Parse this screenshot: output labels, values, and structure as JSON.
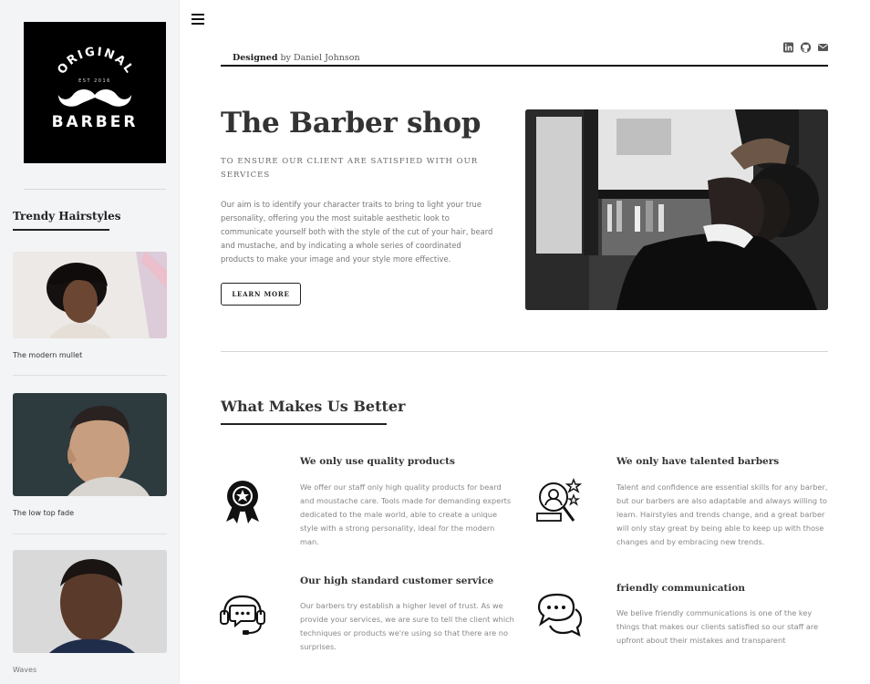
{
  "sidebar": {
    "logo": {
      "top": "ORIGINAL",
      "est": "EST 2016",
      "bottom": "BARBER"
    },
    "title": "Trendy Hairstyles",
    "items": [
      {
        "label": "The modern mullet"
      },
      {
        "label": "The low top fade"
      },
      {
        "label": "Waves"
      }
    ]
  },
  "header": {
    "designed_label": "Designed",
    "designed_by": "by Daniel Johnson",
    "socials": [
      "linkedin-icon",
      "github-icon",
      "mail-icon"
    ]
  },
  "hero": {
    "title": "The Barber shop",
    "subtitle": "To ensure our client are satisfied with our services",
    "body": "Our aim is to identify your character traits to bring to light your true personality, offering you the most suitable aesthetic look to communicate yourself both with the style of the cut of your hair, beard and mustache, and by indicating a whole series of coordinated products to make your image and your style more effective.",
    "button": "LEARN MORE"
  },
  "section": {
    "title": "What Makes Us Better",
    "features": [
      {
        "icon": "award-ribbon-icon",
        "title": "We only use quality products",
        "body": "We offer our staff only high quality products for beard and moustache care. Tools made for demanding experts dedicated to the male world, able to create a unique style with a strong personality, ideal for the modern man."
      },
      {
        "icon": "talent-star-icon",
        "title": "We only have talented barbers",
        "body": "Talent and confidence are essential skills for any barber, but our barbers are also adaptable and always willing to learn. Hairstyles and trends change, and a great barber will only stay great by being able to keep up with those changes and by embracing new trends."
      },
      {
        "icon": "headset-chat-icon",
        "title": "Our high standard customer service",
        "body": "Our barbers try establish a higher level of trust. As we provide your services, we are sure to tell the client which techniques or products we're using so that there are no surprises."
      },
      {
        "icon": "chat-bubbles-icon",
        "title": "friendly communication",
        "body": "We belive friendly communications is one of the key things that makes our clients satisfied so our staff are upfront about their mistakes and transparent"
      }
    ]
  }
}
